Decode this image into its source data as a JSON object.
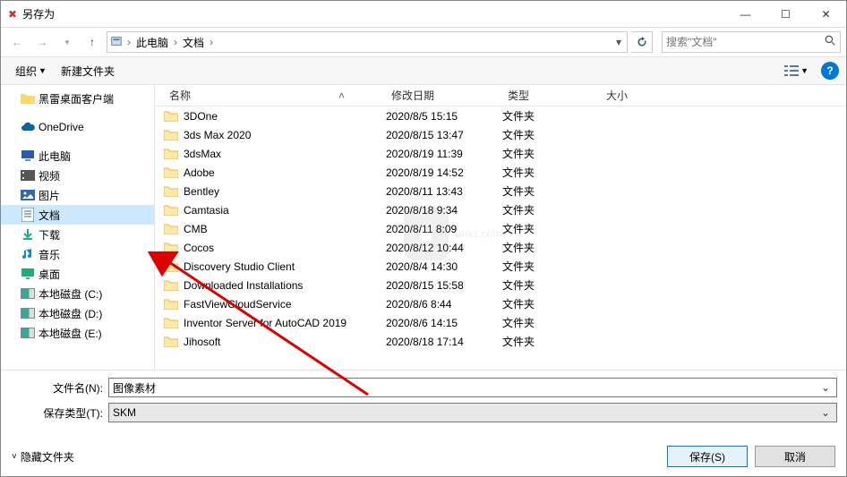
{
  "window": {
    "title": "另存为"
  },
  "nav": {
    "crumbs": [
      "此电脑",
      "文档"
    ],
    "search_placeholder": "搜索\"文档\""
  },
  "toolbar": {
    "organize": "组织",
    "new_folder": "新建文件夹"
  },
  "tree": [
    {
      "label": "黑雷桌面客户端",
      "icon": "folder",
      "color": "#ffd66e"
    },
    {
      "label": "",
      "icon": "",
      "spacer": true
    },
    {
      "label": "OneDrive",
      "icon": "cloud",
      "color": "#0a64a4"
    },
    {
      "label": "",
      "icon": "",
      "spacer": true
    },
    {
      "label": "此电脑",
      "icon": "pc",
      "color": "#2a5caa"
    },
    {
      "label": "视频",
      "icon": "video",
      "color": "#555"
    },
    {
      "label": "图片",
      "icon": "image",
      "color": "#36a"
    },
    {
      "label": "文档",
      "icon": "doc",
      "color": "#36a",
      "selected": true
    },
    {
      "label": "下载",
      "icon": "download",
      "color": "#2a8"
    },
    {
      "label": "音乐",
      "icon": "music",
      "color": "#18c"
    },
    {
      "label": "桌面",
      "icon": "desktop",
      "color": "#2a7"
    },
    {
      "label": "本地磁盘 (C:)",
      "icon": "disk"
    },
    {
      "label": "本地磁盘 (D:)",
      "icon": "disk"
    },
    {
      "label": "本地磁盘 (E:)",
      "icon": "disk"
    }
  ],
  "columns": {
    "name": "名称",
    "date": "修改日期",
    "type": "类型",
    "size": "大小"
  },
  "files": [
    {
      "name": "3DOne",
      "date": "2020/8/5 15:15",
      "type": "文件夹"
    },
    {
      "name": "3ds Max 2020",
      "date": "2020/8/15 13:47",
      "type": "文件夹"
    },
    {
      "name": "3dsMax",
      "date": "2020/8/19 11:39",
      "type": "文件夹"
    },
    {
      "name": "Adobe",
      "date": "2020/8/19 14:52",
      "type": "文件夹"
    },
    {
      "name": "Bentley",
      "date": "2020/8/11 13:43",
      "type": "文件夹"
    },
    {
      "name": "Camtasia",
      "date": "2020/8/18 9:34",
      "type": "文件夹"
    },
    {
      "name": "CMB",
      "date": "2020/8/11 8:09",
      "type": "文件夹"
    },
    {
      "name": "Cocos",
      "date": "2020/8/12 10:44",
      "type": "文件夹"
    },
    {
      "name": "Discovery Studio Client",
      "date": "2020/8/4 14:30",
      "type": "文件夹"
    },
    {
      "name": "Downloaded Installations",
      "date": "2020/8/15 15:58",
      "type": "文件夹"
    },
    {
      "name": "FastViewCloudService",
      "date": "2020/8/6 8:44",
      "type": "文件夹"
    },
    {
      "name": "Inventor Server for AutoCAD 2019",
      "date": "2020/8/6 14:15",
      "type": "文件夹"
    },
    {
      "name": "Jihosoft",
      "date": "2020/8/18 17:14",
      "type": "文件夹"
    }
  ],
  "filename": {
    "label": "文件名(N):",
    "value": "图像素材"
  },
  "filetype": {
    "label": "保存类型(T):",
    "value": "SKM"
  },
  "footer": {
    "hide": "隐藏文件夹",
    "save": "保存(S)",
    "cancel": "取消"
  },
  "watermark": "anxz.com"
}
